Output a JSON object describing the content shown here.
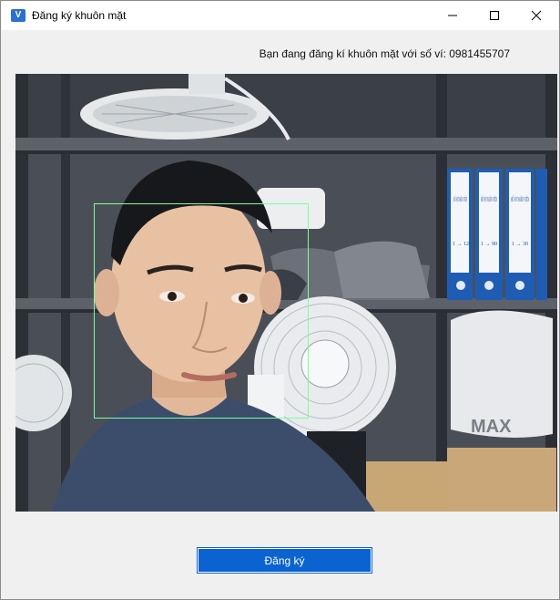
{
  "window": {
    "title": "Đăng ký khuôn mặt",
    "app_icon": "app-icon",
    "controls": [
      "minimize-icon",
      "maximize-icon",
      "close-icon"
    ]
  },
  "status": {
    "text": "Bạn đang đăng kí khuôn mặt với số ví: 0981455707"
  },
  "camera": {
    "shelf_labels": {
      "binder1": "HỒ SƠ NHÂN VIÊN",
      "binder2": "HỒ SƠ NHÂN VIÊN",
      "binder3": "HỒ SƠ NHÂN VIÊN",
      "range1": "1 → 120",
      "range2": "1 → 90",
      "range3": "1 → 30",
      "box": "MAX"
    }
  },
  "actions": {
    "register_label": "Đăng ký"
  },
  "colors": {
    "accent": "#0a63d1",
    "face_box": "#7dff9e"
  }
}
